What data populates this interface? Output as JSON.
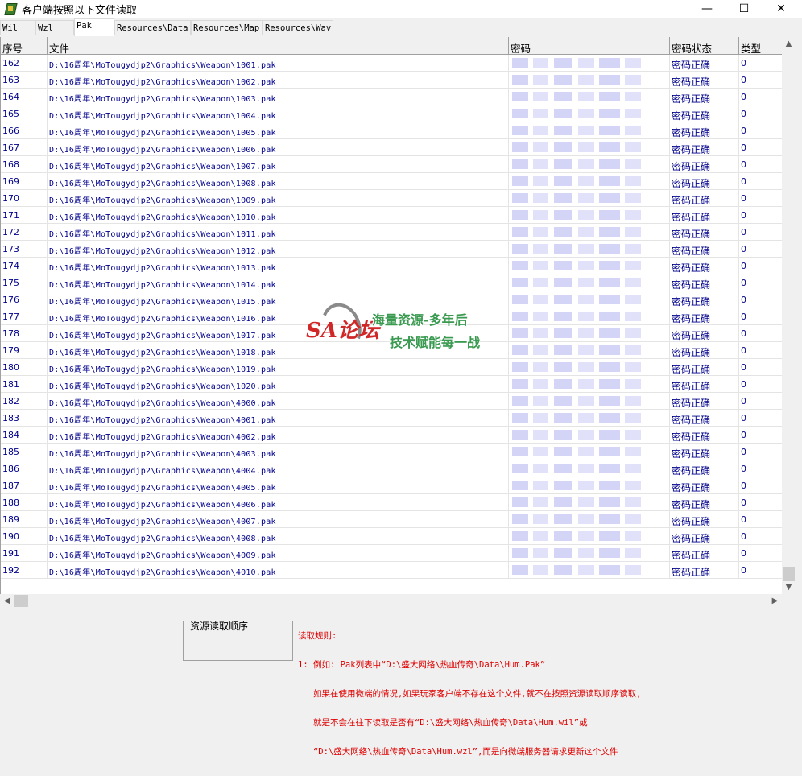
{
  "window": {
    "title": "客户端按照以下文件读取",
    "icon": "app-icon",
    "controls": {
      "minimize": "—",
      "maximize": "☐",
      "close": "✕"
    }
  },
  "tabs": [
    {
      "label": "Wil",
      "active": false
    },
    {
      "label": "Wzl",
      "active": false
    },
    {
      "label": "Pak",
      "active": true
    },
    {
      "label": "Resources\\Data",
      "active": false
    },
    {
      "label": "Resources\\Map",
      "active": false
    },
    {
      "label": "Resources\\Wav",
      "active": false
    }
  ],
  "grid": {
    "columns": [
      "序号",
      "文件",
      "密码",
      "密码状态",
      "类型"
    ],
    "rows": [
      {
        "seq": "162",
        "file": "D:\\16周年\\MoTougydjp2\\Graphics\\Weapon\\1001.pak",
        "status": "密码正确",
        "type": "0"
      },
      {
        "seq": "163",
        "file": "D:\\16周年\\MoTougydjp2\\Graphics\\Weapon\\1002.pak",
        "status": "密码正确",
        "type": "0"
      },
      {
        "seq": "164",
        "file": "D:\\16周年\\MoTougydjp2\\Graphics\\Weapon\\1003.pak",
        "status": "密码正确",
        "type": "0"
      },
      {
        "seq": "165",
        "file": "D:\\16周年\\MoTougydjp2\\Graphics\\Weapon\\1004.pak",
        "status": "密码正确",
        "type": "0"
      },
      {
        "seq": "166",
        "file": "D:\\16周年\\MoTougydjp2\\Graphics\\Weapon\\1005.pak",
        "status": "密码正确",
        "type": "0"
      },
      {
        "seq": "167",
        "file": "D:\\16周年\\MoTougydjp2\\Graphics\\Weapon\\1006.pak",
        "status": "密码正确",
        "type": "0"
      },
      {
        "seq": "168",
        "file": "D:\\16周年\\MoTougydjp2\\Graphics\\Weapon\\1007.pak",
        "status": "密码正确",
        "type": "0"
      },
      {
        "seq": "169",
        "file": "D:\\16周年\\MoTougydjp2\\Graphics\\Weapon\\1008.pak",
        "status": "密码正确",
        "type": "0"
      },
      {
        "seq": "170",
        "file": "D:\\16周年\\MoTougydjp2\\Graphics\\Weapon\\1009.pak",
        "status": "密码正确",
        "type": "0"
      },
      {
        "seq": "171",
        "file": "D:\\16周年\\MoTougydjp2\\Graphics\\Weapon\\1010.pak",
        "status": "密码正确",
        "type": "0"
      },
      {
        "seq": "172",
        "file": "D:\\16周年\\MoTougydjp2\\Graphics\\Weapon\\1011.pak",
        "status": "密码正确",
        "type": "0"
      },
      {
        "seq": "173",
        "file": "D:\\16周年\\MoTougydjp2\\Graphics\\Weapon\\1012.pak",
        "status": "密码正确",
        "type": "0"
      },
      {
        "seq": "174",
        "file": "D:\\16周年\\MoTougydjp2\\Graphics\\Weapon\\1013.pak",
        "status": "密码正确",
        "type": "0"
      },
      {
        "seq": "175",
        "file": "D:\\16周年\\MoTougydjp2\\Graphics\\Weapon\\1014.pak",
        "status": "密码正确",
        "type": "0"
      },
      {
        "seq": "176",
        "file": "D:\\16周年\\MoTougydjp2\\Graphics\\Weapon\\1015.pak",
        "status": "密码正确",
        "type": "0"
      },
      {
        "seq": "177",
        "file": "D:\\16周年\\MoTougydjp2\\Graphics\\Weapon\\1016.pak",
        "status": "密码正确",
        "type": "0"
      },
      {
        "seq": "178",
        "file": "D:\\16周年\\MoTougydjp2\\Graphics\\Weapon\\1017.pak",
        "status": "密码正确",
        "type": "0"
      },
      {
        "seq": "179",
        "file": "D:\\16周年\\MoTougydjp2\\Graphics\\Weapon\\1018.pak",
        "status": "密码正确",
        "type": "0"
      },
      {
        "seq": "180",
        "file": "D:\\16周年\\MoTougydjp2\\Graphics\\Weapon\\1019.pak",
        "status": "密码正确",
        "type": "0"
      },
      {
        "seq": "181",
        "file": "D:\\16周年\\MoTougydjp2\\Graphics\\Weapon\\1020.pak",
        "status": "密码正确",
        "type": "0"
      },
      {
        "seq": "182",
        "file": "D:\\16周年\\MoTougydjp2\\Graphics\\Weapon\\4000.pak",
        "status": "密码正确",
        "type": "0"
      },
      {
        "seq": "183",
        "file": "D:\\16周年\\MoTougydjp2\\Graphics\\Weapon\\4001.pak",
        "status": "密码正确",
        "type": "0"
      },
      {
        "seq": "184",
        "file": "D:\\16周年\\MoTougydjp2\\Graphics\\Weapon\\4002.pak",
        "status": "密码正确",
        "type": "0"
      },
      {
        "seq": "185",
        "file": "D:\\16周年\\MoTougydjp2\\Graphics\\Weapon\\4003.pak",
        "status": "密码正确",
        "type": "0"
      },
      {
        "seq": "186",
        "file": "D:\\16周年\\MoTougydjp2\\Graphics\\Weapon\\4004.pak",
        "status": "密码正确",
        "type": "0"
      },
      {
        "seq": "187",
        "file": "D:\\16周年\\MoTougydjp2\\Graphics\\Weapon\\4005.pak",
        "status": "密码正确",
        "type": "0"
      },
      {
        "seq": "188",
        "file": "D:\\16周年\\MoTougydjp2\\Graphics\\Weapon\\4006.pak",
        "status": "密码正确",
        "type": "0"
      },
      {
        "seq": "189",
        "file": "D:\\16周年\\MoTougydjp2\\Graphics\\Weapon\\4007.pak",
        "status": "密码正确",
        "type": "0"
      },
      {
        "seq": "190",
        "file": "D:\\16周年\\MoTougydjp2\\Graphics\\Weapon\\4008.pak",
        "status": "密码正确",
        "type": "0"
      },
      {
        "seq": "191",
        "file": "D:\\16周年\\MoTougydjp2\\Graphics\\Weapon\\4009.pak",
        "status": "密码正确",
        "type": "0"
      },
      {
        "seq": "192",
        "file": "D:\\16周年\\MoTougydjp2\\Graphics\\Weapon\\4010.pak",
        "status": "密码正确",
        "type": "0"
      }
    ]
  },
  "bottom": {
    "order_label": "资源读取顺序",
    "rules_lines": [
      "读取规则:",
      "1: 例如: Pak列表中“D:\\盛大网络\\热血传奇\\Data\\Hum.Pak”",
      "   如果在使用微端的情况,如果玩家客户端不存在这个文件,就不在按照资源读取顺序读取,",
      "   就是不会在往下读取是否有“D:\\盛大网络\\热血传奇\\Data\\Hum.wil”或",
      "   “D:\\盛大网络\\热血传奇\\Data\\Hum.wzl”,而是向微端服务器请求更新这个文件"
    ]
  },
  "watermark": {
    "logo": "SA论坛",
    "line1": "海量资源-多年后",
    "line2": "技术赋能每一战"
  },
  "colors": {
    "row_text": "#00008b",
    "rules_text": "#e00000",
    "blurred_password": "#c9c9f5"
  }
}
